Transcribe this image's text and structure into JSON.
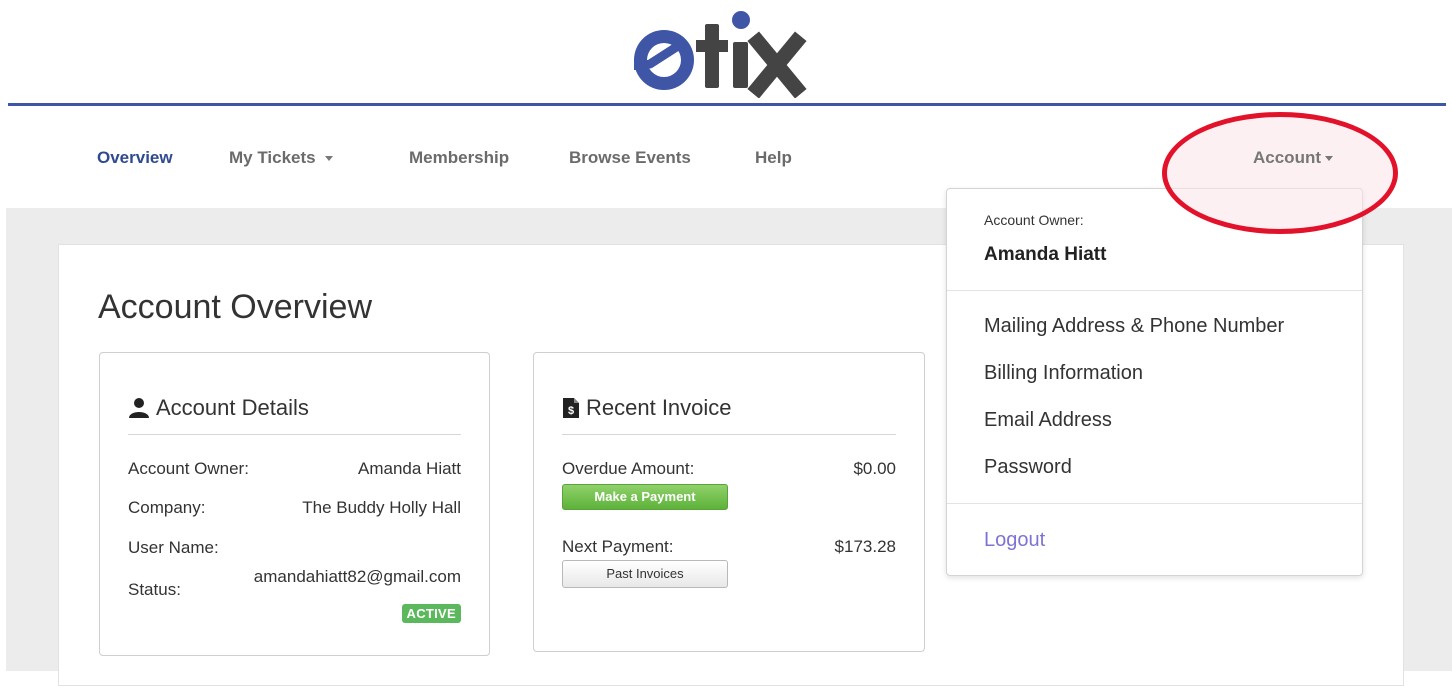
{
  "brand": {
    "name": "etix",
    "blue": "#3f56a6",
    "gray": "#444444"
  },
  "nav": {
    "items": [
      {
        "label": "Overview",
        "active": true
      },
      {
        "label": "My Tickets",
        "has_caret": true
      },
      {
        "label": "Membership"
      },
      {
        "label": "Browse Events"
      },
      {
        "label": "Help"
      }
    ],
    "account_label": "Account"
  },
  "page": {
    "title": "Account Overview"
  },
  "account_details": {
    "title": "Account Details",
    "icon": "user-icon",
    "rows": [
      {
        "label": "Account Owner:",
        "value": "Amanda Hiatt"
      },
      {
        "label": "Company:",
        "value": "The Buddy Holly Hall"
      },
      {
        "label": "User Name:",
        "value": ""
      },
      {
        "label": "Status:",
        "value": "amandahiatt82@gmail.com"
      }
    ],
    "status_badge": "ACTIVE",
    "status_color": "#5cb85c"
  },
  "recent_invoice": {
    "title": "Recent Invoice",
    "icon": "invoice-icon",
    "overdue_label": "Overdue Amount:",
    "overdue_value": "$0.00",
    "pay_button": "Make a Payment",
    "next_label": "Next Payment:",
    "next_value": "$173.28",
    "past_button": "Past Invoices"
  },
  "account_dropdown": {
    "owner_label": "Account Owner:",
    "owner_name": "Amanda Hiatt",
    "items": [
      "Mailing Address & Phone Number",
      "Billing Information",
      "Email Address",
      "Password"
    ],
    "logout": "Logout",
    "highlight_color": "#e2122a"
  }
}
